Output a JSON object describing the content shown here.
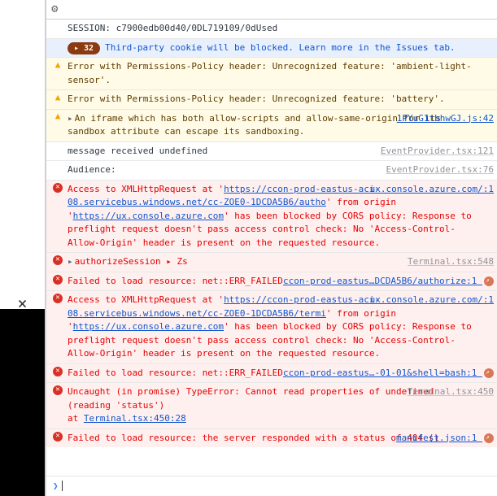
{
  "toolbar": {
    "gear": "⚙"
  },
  "leftPanel": {
    "close": "×"
  },
  "rows": [
    {
      "type": "plain first",
      "text": "SESSION: c7900edb00d40/0DL719109/0dUsed"
    },
    {
      "type": "info",
      "badge": "▸ 32",
      "text": "Third-party cookie will be blocked. Learn more in the Issues tab."
    },
    {
      "type": "warn",
      "text": "Error with Permissions-Policy header: Unrecognized feature: 'ambient-light-sensor'."
    },
    {
      "type": "warn",
      "text": "Error with Permissions-Policy header: Unrecognized feature: 'battery'."
    },
    {
      "type": "warn",
      "tri": true,
      "text": "An iframe which has both allow-scripts and allow-same-origin for its sandbox attribute can escape its sandboxing.",
      "src": "1PYuG1tbhwGJ.js:42",
      "srclink": true
    },
    {
      "type": "plain",
      "text": "message received undefined",
      "src": "EventProvider.tsx:121"
    },
    {
      "type": "plain",
      "text": "Audience:",
      "src": "EventProvider.tsx:76"
    },
    {
      "type": "err",
      "pre": "Access to XMLHttpRequest at '",
      "link1": "https://ccon-prod-eastus-aci-08.servicebus.windows.net/cc-ZOE0-1DCDA5B6/autho",
      "mid": "' from origin '",
      "link2": "https://ux.console.azure.com",
      "post": "' has been blocked by CORS policy: Response to preflight request doesn't pass access control check: No 'Access-Control-Allow-Origin' header is present on the requested resource.",
      "src": "ux.console.azure.com/:1",
      "srclink": true
    },
    {
      "type": "err",
      "tri": true,
      "text": "authorizeSession ▸ Zs",
      "src": "Terminal.tsx:548"
    },
    {
      "type": "err",
      "text": "Failed to load resource: net::ERR_FAILED",
      "src": "ccon-prod-eastus…DCDA5B6/authorize:1",
      "srclink": true,
      "ext": true
    },
    {
      "type": "err",
      "pre": "Access to XMLHttpRequest at '",
      "link1": "https://ccon-prod-eastus-aci-08.servicebus.windows.net/cc-ZOE0-1DCDA5B6/termi",
      "mid": "' from origin '",
      "link2": "https://ux.console.azure.com",
      "post": "' has been blocked by CORS policy: Response to preflight request doesn't pass access control check: No 'Access-Control-Allow-Origin' header is present on the requested resource.",
      "src": "ux.console.azure.com/:1",
      "srclink": true
    },
    {
      "type": "err",
      "text": "Failed to load resource: net::ERR_FAILED",
      "src": "ccon-prod-eastus…-01-01&shell=bash:1",
      "srclink": true,
      "ext": true
    },
    {
      "type": "err",
      "text": "Uncaught (in promise) TypeError: Cannot read properties of undefined (reading 'status')",
      "indent": "        at ",
      "indentLink": "Terminal.tsx:450:28",
      "src": "Terminal.tsx:450"
    },
    {
      "type": "err",
      "text": "Failed to load resource: the server responded with a status of 404 ()",
      "src": "manifest.json:1",
      "srclink": true,
      "ext": true
    }
  ],
  "prompt": {
    "symbol": "❯"
  }
}
